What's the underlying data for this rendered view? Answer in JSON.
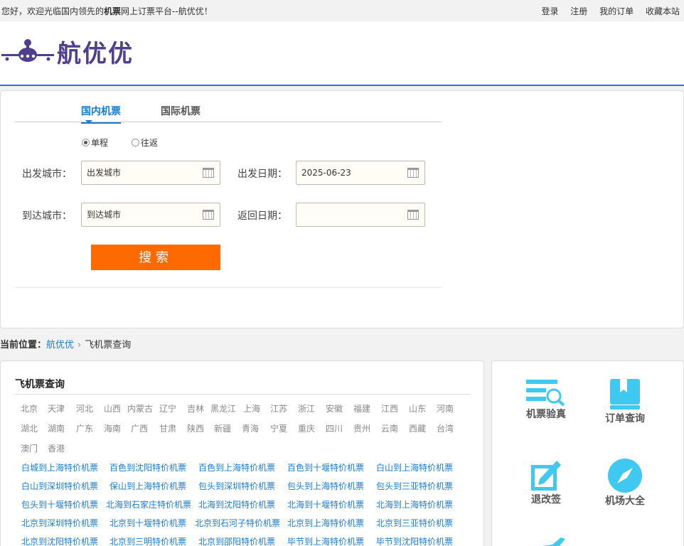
{
  "topbar": {
    "welcome_pre": "您好，欢迎光临国内领先的",
    "welcome_bold": "机票",
    "welcome_post": "网上订票平台--航优优！",
    "login": "登录",
    "register": "注册",
    "my_orders": "我的订单",
    "favorite": "收藏本站"
  },
  "header": {
    "logo_text": "航优优"
  },
  "search": {
    "tabs": [
      "国内机票",
      "国际机票"
    ],
    "trip_types": [
      "单程",
      "往返"
    ],
    "depart_city_label": "出发城市：",
    "depart_city_value": "出发城市",
    "arrive_city_label": "到达城市：",
    "arrive_city_value": "到达城市",
    "depart_date_label": "出发日期：",
    "depart_date_value": "2025-06-23",
    "return_date_label": "返回日期：",
    "return_date_value": "",
    "search_button": "搜索"
  },
  "breadcrumb": {
    "label": "当前位置：",
    "home": "航优优",
    "current": "飞机票查询"
  },
  "main": {
    "title": "飞机票查询",
    "provinces": [
      "北京",
      "天津",
      "河北",
      "山西",
      "内蒙古",
      "辽宁",
      "吉林",
      "黑龙江",
      "上海",
      "江苏",
      "浙江",
      "安徽",
      "福建",
      "江西",
      "山东",
      "河南",
      "湖北",
      "湖南",
      "广东",
      "海南",
      "广西",
      "甘肃",
      "陕西",
      "新疆",
      "青海",
      "宁夏",
      "重庆",
      "四川",
      "贵州",
      "云南",
      "西藏",
      "台湾",
      "澳门",
      "香港"
    ],
    "routes": [
      [
        "白城到上海特价机票",
        "百色到沈阳特价机票",
        "百色到上海特价机票",
        "百色到十堰特价机票",
        "白山到上海特价机票"
      ],
      [
        "白山到深圳特价机票",
        "保山到上海特价机票",
        "包头到深圳特价机票",
        "包头到上海特价机票",
        "包头到三亚特价机票"
      ],
      [
        "包头到十堰特价机票",
        "北海到石家庄特价机票",
        "北海到沈阳特价机票",
        "北海到十堰特价机票",
        "北海到上海特价机票"
      ],
      [
        "北京到深圳特价机票",
        "北京到十堰特价机票",
        "北京到石河子特价机票",
        "北京到上海特价机票",
        "北京到三亚特价机票"
      ],
      [
        "北京到沈阳特价机票",
        "北京到三明特价机票",
        "北京到邵阳特价机票",
        "毕节到上海特价机票",
        "毕节到沈阳特价机票"
      ]
    ]
  },
  "services": [
    {
      "label": "机票验真",
      "icon": "ticket-verify-icon"
    },
    {
      "label": "订单查询",
      "icon": "order-book-icon"
    },
    {
      "label": "退改签",
      "icon": "edit-icon"
    },
    {
      "label": "机场大全",
      "icon": "compass-icon"
    }
  ],
  "colors": {
    "accent": "#1a7bd0",
    "button": "#ff6a00",
    "logo": "#4f3f8c",
    "icon": "#3fc8f0"
  }
}
